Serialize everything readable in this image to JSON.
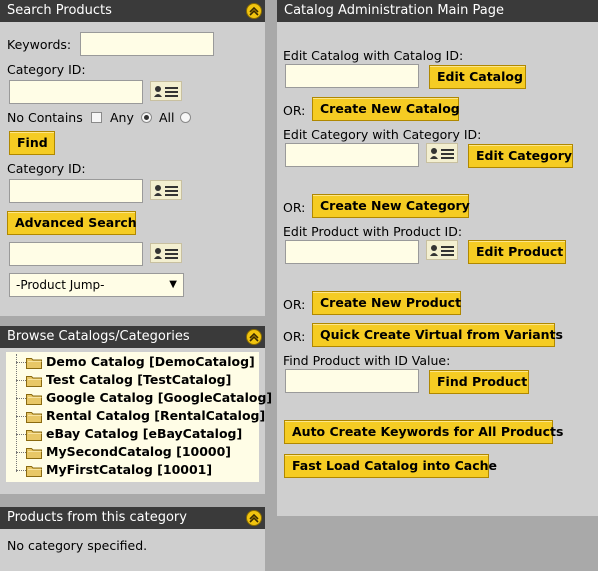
{
  "search_panel": {
    "title": "Search Products",
    "keywords_label": "Keywords:",
    "keywords_value": "",
    "category_id_label": "Category ID:",
    "category_id_value": "",
    "no_contains_label": "No Contains",
    "any_label": "Any",
    "all_label": "All",
    "find_label": "Find",
    "category_id2_label": "Category ID:",
    "category_id2_value": "",
    "advanced_search_label": "Advanced Search",
    "product_jump_value": "",
    "product_jump_select": "-Product Jump-"
  },
  "browse_panel": {
    "title": "Browse Catalogs/Categories",
    "catalogs": [
      {
        "label": "Demo Catalog [DemoCatalog]"
      },
      {
        "label": "Test Catalog [TestCatalog]"
      },
      {
        "label": "Google Catalog [GoogleCatalog]"
      },
      {
        "label": "Rental Catalog [RentalCatalog]"
      },
      {
        "label": "eBay Catalog [eBayCatalog]"
      },
      {
        "label": "MySecondCatalog [10000]"
      },
      {
        "label": "MyFirstCatalog [10001]"
      }
    ]
  },
  "products_panel": {
    "title": "Products from this category",
    "empty_text": "No category specified."
  },
  "main": {
    "title": "Catalog Administration Main Page",
    "edit_catalog_label": "Edit Catalog with Catalog ID:",
    "edit_catalog_button": "Edit Catalog",
    "or1": "OR:",
    "create_catalog_button": "Create New Catalog",
    "edit_category_label": "Edit Category with Category ID:",
    "edit_category_button": "Edit Category",
    "or2": "OR:",
    "create_category_button": "Create New Category",
    "edit_product_label": "Edit Product with Product ID:",
    "edit_product_button": "Edit Product",
    "or3": "OR:",
    "create_product_button": "Create New Product",
    "or4": "OR:",
    "quick_create_button": "Quick Create Virtual from Variants",
    "find_product_label": "Find Product with ID Value:",
    "find_product_button": "Find Product",
    "auto_keywords_button": "Auto Create Keywords for All Products",
    "fast_load_button": "Fast Load Catalog into Cache"
  },
  "colors": {
    "header_bg": "#3a3a3a",
    "panel_bg": "#cfcfcf",
    "button_bg": "#f5cc23",
    "field_bg": "#fffde6",
    "page_bg": "#a9a9a9"
  },
  "icons": [
    "collapse-up-icon",
    "lookup-card-icon",
    "folder-icon",
    "dropdown-arrow-icon"
  ]
}
